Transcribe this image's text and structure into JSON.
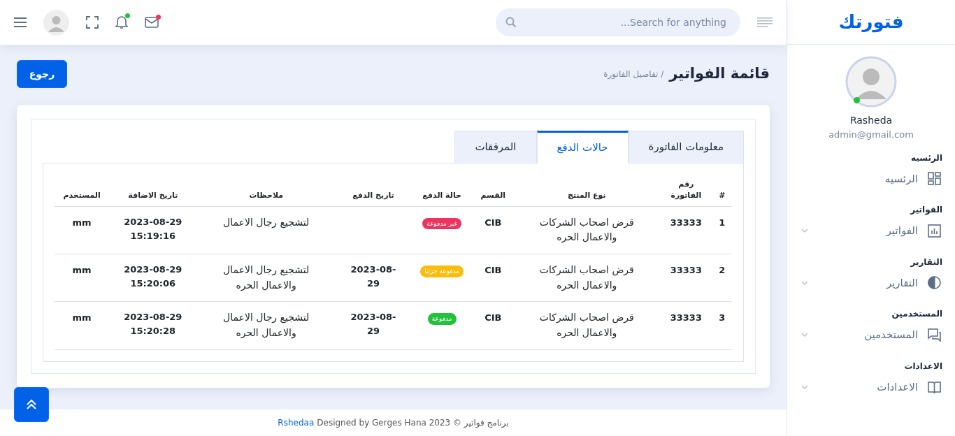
{
  "brand": "فتورتك",
  "search": {
    "placeholder": "...Search for anything"
  },
  "notifications": {
    "bell_dot": true,
    "mail_dot": true
  },
  "profile": {
    "name": "Rasheda",
    "email": "admin@gmail.com",
    "online": true
  },
  "sidebar": [
    {
      "heading": "الرئسيه",
      "label": "الرئسيه",
      "expandable": false
    },
    {
      "heading": "الفواتير",
      "label": "الفواتير",
      "expandable": true
    },
    {
      "heading": "التقارير",
      "label": "التقارير",
      "expandable": true
    },
    {
      "heading": "المستخدمين",
      "label": "المستخدمين",
      "expandable": true
    },
    {
      "heading": "الاعدادات",
      "label": "الاعدادات",
      "expandable": true
    }
  ],
  "page": {
    "title": "قائمة الفواتير",
    "breadcrumb": "/ تفاصيل الفاتورة",
    "back_button": "رجوع"
  },
  "tabs": [
    {
      "label": "معلومات الفاتورة",
      "selected": false
    },
    {
      "label": "حالات الدفع",
      "selected": true
    },
    {
      "label": "المرفقات",
      "selected": false
    }
  ],
  "table": {
    "columns": [
      "#",
      "رقم الفاتورة",
      "نوع المنتج",
      "القسم",
      "حالة الدفع",
      "تاريخ الدفع",
      "ملاحظات",
      "تاريخ الاضافة",
      "المستخدم"
    ],
    "rows": [
      {
        "cells": [
          "1",
          "33333",
          "قرض اصحاب الشركات والاعمال الحره",
          "CIB",
          {
            "badge": "غير مدفوعة",
            "color": "#ee335e"
          },
          "",
          "لتشجيع رجال الاعمال",
          "2023-08-29 15:19:16",
          "mm"
        ]
      },
      {
        "cells": [
          "2",
          "33333",
          "قرض اصحاب الشركات والاعمال الحره",
          "CIB",
          {
            "badge": "مدفوعة جزئيا",
            "color": "#fbbc0b"
          },
          "2023-08-29",
          "لتشجيع رجال الاعمال والاعمال الحره",
          "2023-08-29 15:20:06",
          "mm"
        ]
      },
      {
        "cells": [
          "3",
          "33333",
          "قرض اصحاب الشركات والاعمال الحره",
          "CIB",
          {
            "badge": "مدفوعة",
            "color": "#22c03c"
          },
          "2023-08-29",
          "لتشجيع رجال الاعمال والاعمال الحره",
          "2023-08-29 15:20:28",
          "mm"
        ]
      }
    ]
  },
  "footer": {
    "text": "Designed by Gerges Hana 2023 © برنامج فواتير",
    "link": "Rshedaa"
  }
}
